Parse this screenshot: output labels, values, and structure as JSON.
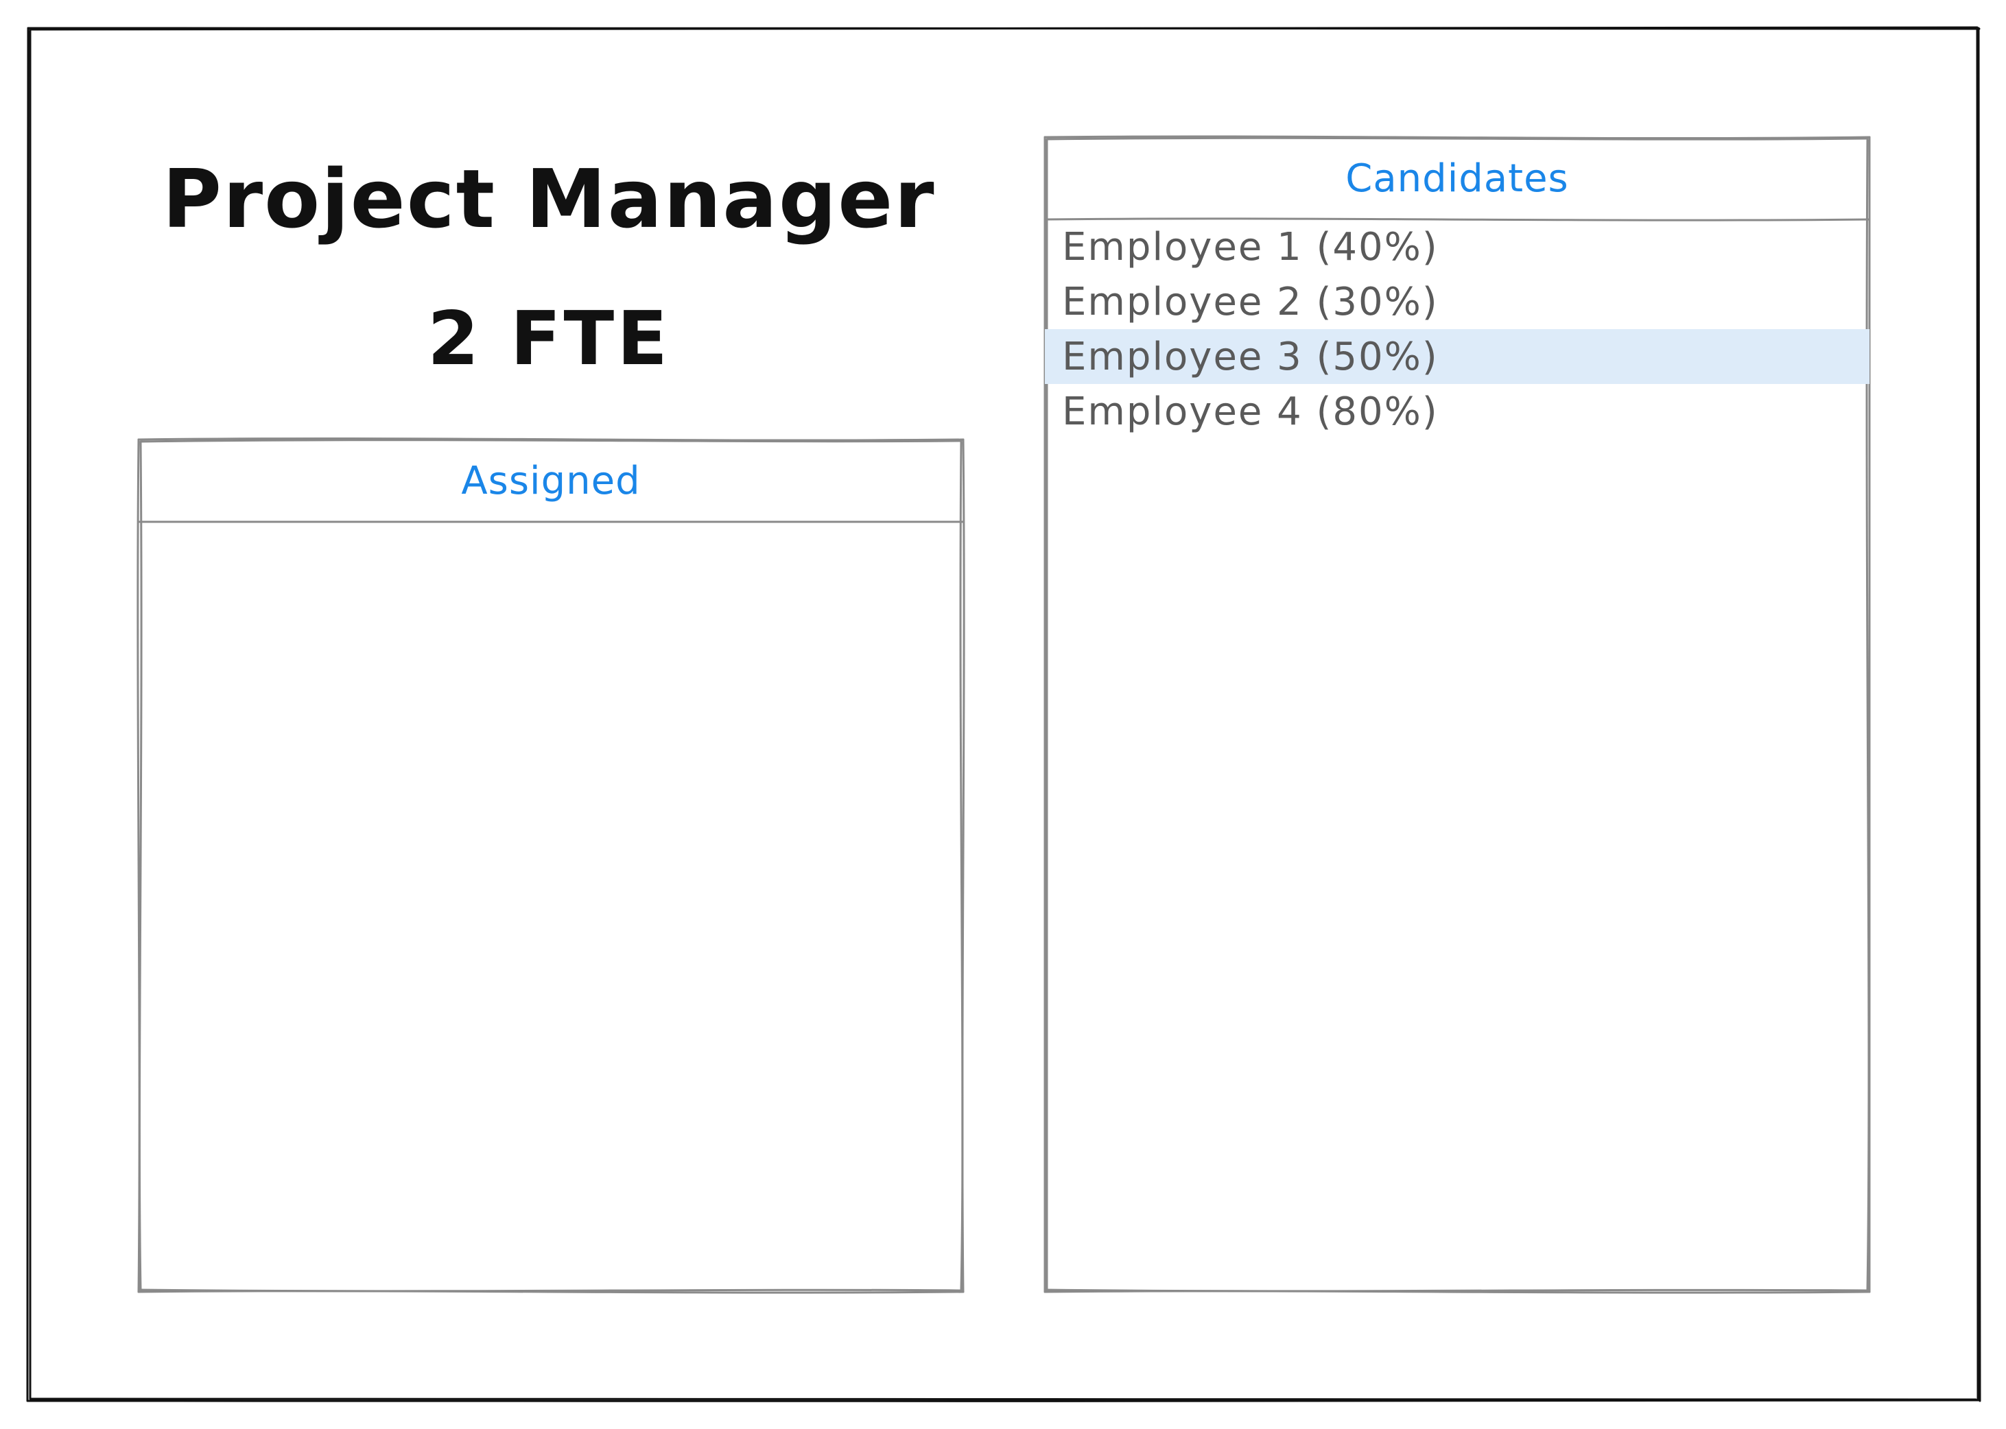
{
  "role": {
    "title": "Project Manager",
    "fte": "2 FTE"
  },
  "assigned": {
    "header": "Assigned",
    "items": []
  },
  "candidates": {
    "header": "Candidates",
    "items": [
      {
        "label": "Employee 1 (40%)",
        "selected": false
      },
      {
        "label": "Employee 2 (30%)",
        "selected": false
      },
      {
        "label": "Employee 3 (50%)",
        "selected": true
      },
      {
        "label": "Employee 4 (80%)",
        "selected": false
      }
    ]
  },
  "colors": {
    "header_text": "#1a86e8",
    "item_text": "#5a5a5a",
    "selected_row": "#ddebf9",
    "border": "#8a8a8a",
    "frame": "#111111"
  }
}
